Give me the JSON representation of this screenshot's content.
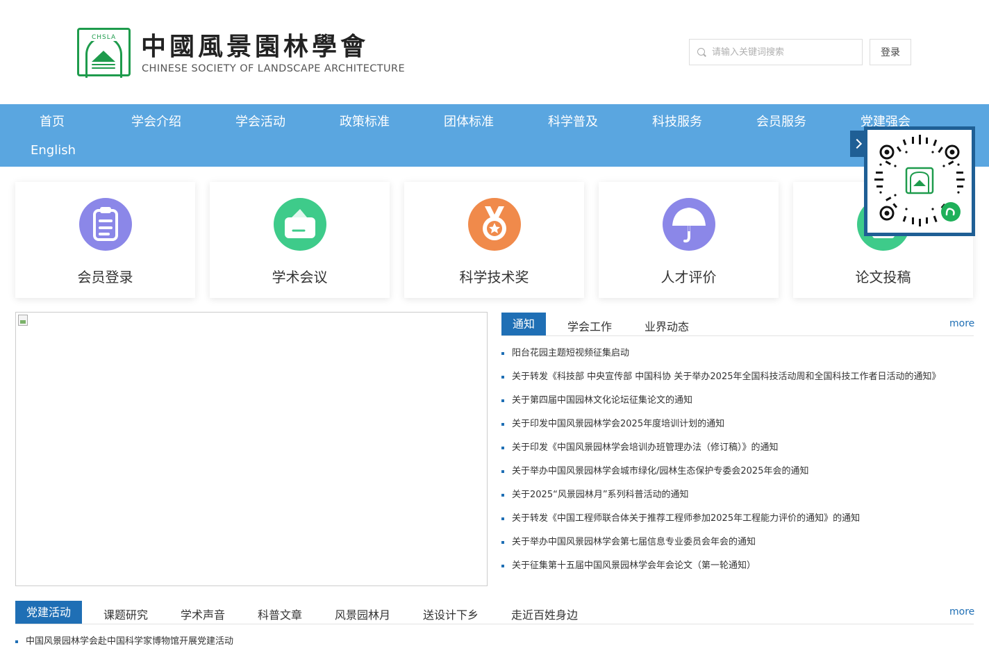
{
  "header": {
    "title": "中國風景園林學會",
    "subtitle": "CHINESE SOCIETY OF LANDSCAPE ARCHITECTURE",
    "emblem_text": "CHSLA",
    "search_placeholder": "请输入关键词搜索",
    "login_label": "登录"
  },
  "nav": {
    "items": [
      "首页",
      "学会介绍",
      "学会活动",
      "政策标准",
      "团体标准",
      "科学普及",
      "科技服务",
      "会员服务",
      "党建强会",
      "English"
    ]
  },
  "services": [
    {
      "label": "会员登录",
      "icon": "clipboard-icon",
      "color": "#8b87e8"
    },
    {
      "label": "学术会议",
      "icon": "wallet-icon",
      "color": "#3ecb8a"
    },
    {
      "label": "科学技术奖",
      "icon": "medal-icon",
      "color": "#f08a4b"
    },
    {
      "label": "人才评价",
      "icon": "umbrella-icon",
      "color": "#8b87e8"
    },
    {
      "label": "论文投稿",
      "icon": "document-icon",
      "color": "#3ecb8a"
    }
  ],
  "news": {
    "tabs": [
      "通知",
      "学会工作",
      "业界动态"
    ],
    "more_label": "more",
    "items": [
      "阳台花园主题短视频征集启动",
      "关于转发《科技部 中央宣传部 中国科协 关于举办2025年全国科技活动周和全国科技工作者日活动的通知》",
      "关于第四届中国园林文化论坛征集论文的通知",
      "关于印发中国风景园林学会2025年度培训计划的通知",
      "关于印发《中国风景园林学会培训办班管理办法（修订稿）》的通知",
      "关于举办中国风景园林学会城市绿化/园林生态保护专委会2025年会的通知",
      "关于2025“风景园林月”系列科普活动的通知",
      "关于转发《中国工程师联合体关于推荐工程师参加2025年工程能力评价的通知》的通知",
      "关于举办中国风景园林学会第七届信息专业委员会年会的通知",
      "关于征集第十五届中国风景园林学会年会论文（第一轮通知）"
    ]
  },
  "party": {
    "tabs": [
      "党建活动",
      "课题研究",
      "学术声音",
      "科普文章",
      "风景园林月",
      "送设计下乡",
      "走近百姓身边"
    ],
    "more_label": "more",
    "items": [
      "中国风景园林学会赴中国科学家博物馆开展党建活动"
    ]
  },
  "colors": {
    "nav_bg": "#5aa6e0",
    "accent": "#1f6fb5",
    "brand_green": "#1e9b4c",
    "qr_border": "#1f5f95"
  }
}
